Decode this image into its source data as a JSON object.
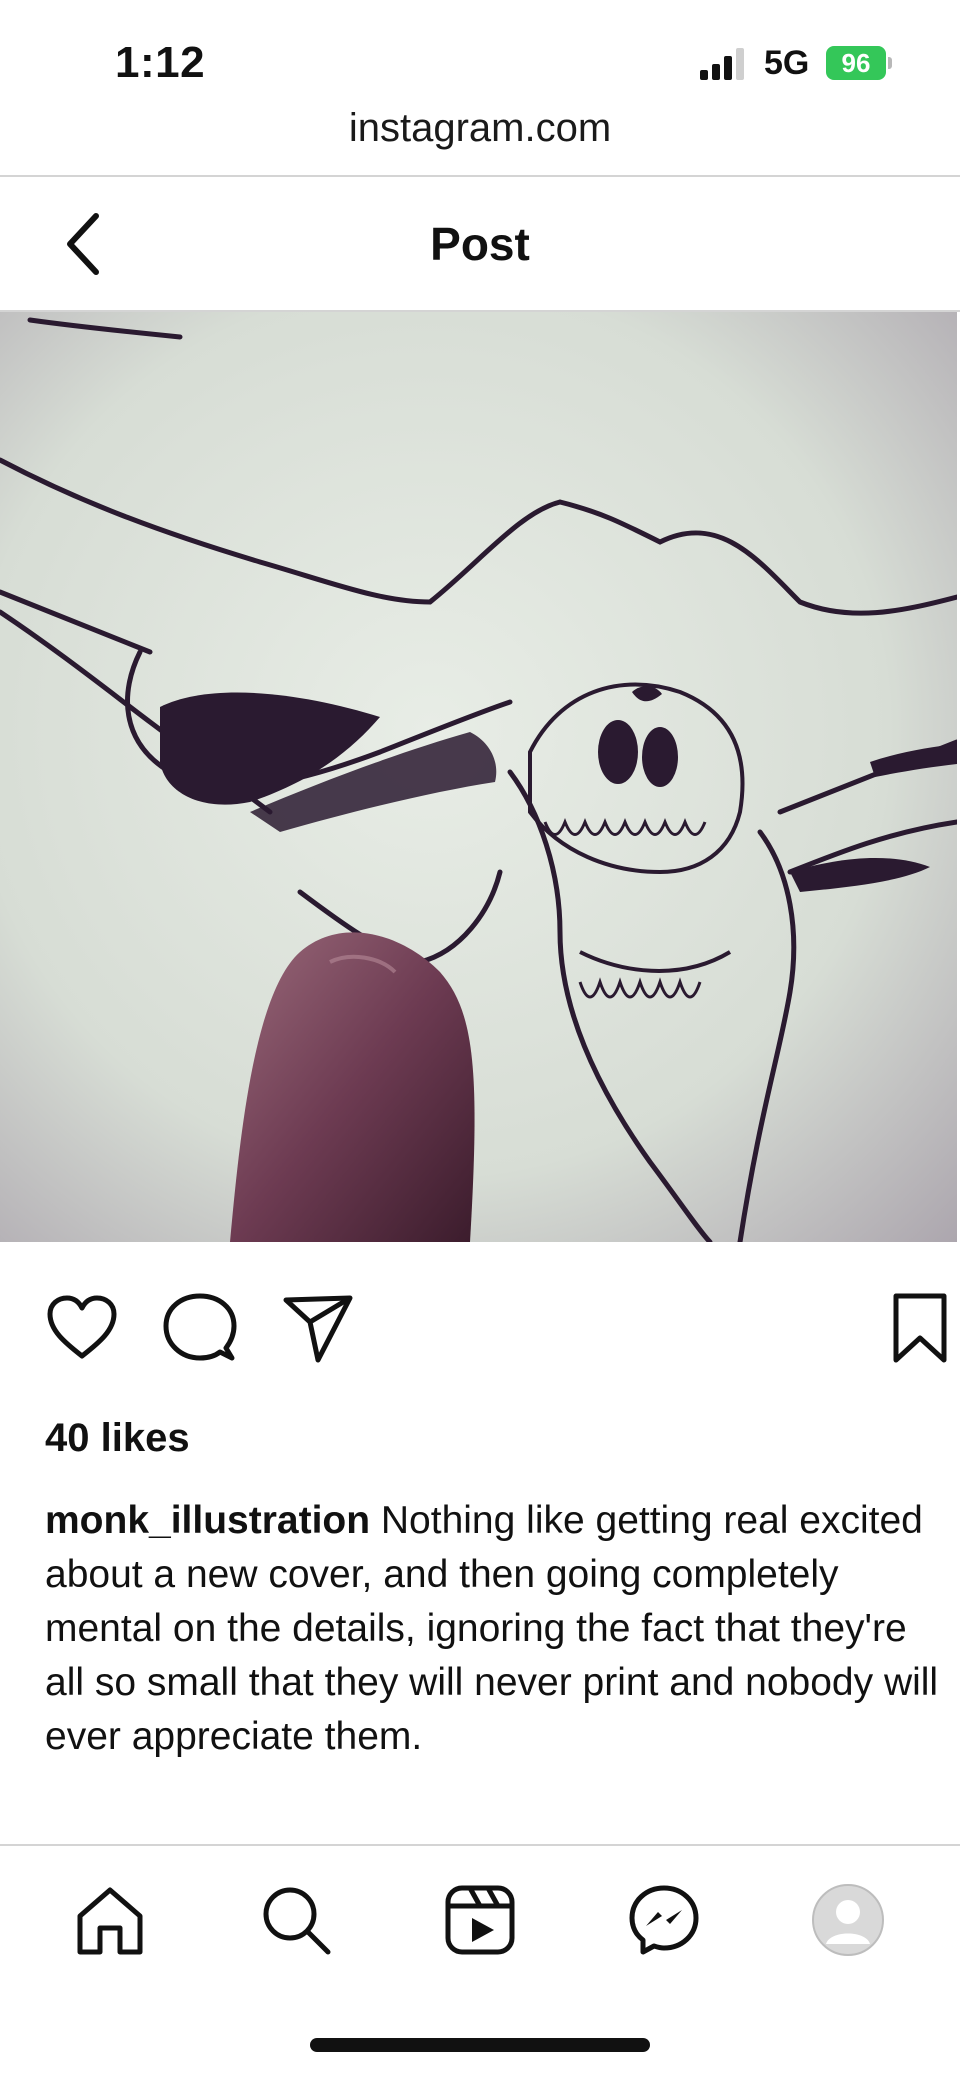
{
  "status_bar": {
    "time": "1:12",
    "network": "5G",
    "battery": "96"
  },
  "browser": {
    "url": "instagram.com"
  },
  "header": {
    "back_icon": "chevron-left-icon",
    "title": "Post"
  },
  "post": {
    "image_description": "pen-and-ink sketch of a horned skull with finger",
    "actions": [
      "heart-icon",
      "comment-icon",
      "share-icon",
      "bookmark-icon"
    ],
    "likes": "40 likes",
    "username": "monk_illustration",
    "caption": "Nothing like getting real excited about a new cover, and then going completely mental on the details, ignoring the fact that they're all so small that they will never print and nobody will ever appreciate them."
  },
  "bottom_nav": {
    "items": [
      "home-icon",
      "search-icon",
      "reels-icon",
      "messenger-icon",
      "profile-avatar"
    ]
  },
  "colors": {
    "battery_green": "#34c759",
    "text": "#111111",
    "divider": "#d4d4d4",
    "ink": "#2a1a30"
  }
}
